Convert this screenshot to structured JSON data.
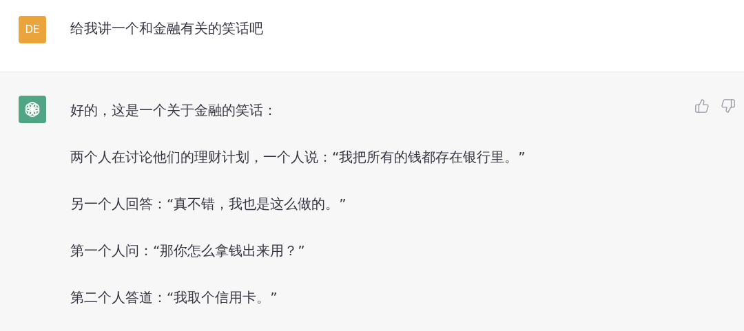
{
  "messages": [
    {
      "kind": "user",
      "avatar": "DE",
      "paragraphs": [
        "给我讲一个和金融有关的笑话吧"
      ]
    },
    {
      "kind": "assistant",
      "paragraphs": [
        "好的，这是一个关于金融的笑话：",
        "两个人在讨论他们的理财计划，一个人说：“我把所有的钱都存在银行里。”",
        "另一个人回答：“真不错，我也是这么做的。”",
        "第一个人问：“那你怎么拿钱出来用？”",
        "第二个人答道：“我取个信用卡。”"
      ]
    }
  ]
}
